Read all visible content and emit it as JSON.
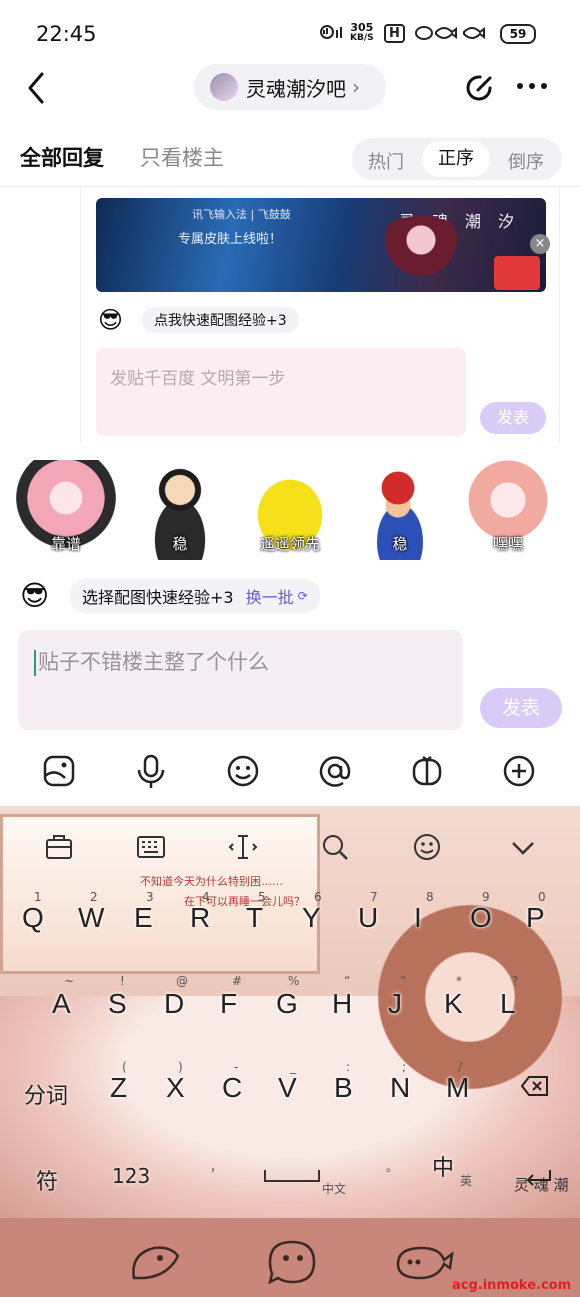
{
  "status_bar": {
    "time": "22:45",
    "net_speed": "305",
    "net_unit": "KB/S",
    "hd_label": "H",
    "battery": "59"
  },
  "nav": {
    "forum_name": "灵魂潮汐吧",
    "forum_chevron": "›"
  },
  "tabs": {
    "all_replies": "全部回复",
    "op_only": "只看楼主",
    "sort_hot": "热门",
    "sort_asc": "正序",
    "sort_desc": "倒序"
  },
  "upper_reply": {
    "banner_line1": "讯飞输入法 | 飞鼓鼓",
    "banner_line2": "专属皮肤上线啦！",
    "banner_title": "灵 魂 潮 汐",
    "banner_close": "×",
    "quick_tip": "点我快速配图经验+3",
    "input_placeholder": "发贴千百度 文明第一步",
    "send_label": "发表"
  },
  "stickers": [
    {
      "label": "靠谱"
    },
    {
      "label": "稳"
    },
    {
      "label": "遥遥领先"
    },
    {
      "label": "稳"
    },
    {
      "label": "嘿嘿"
    }
  ],
  "quick_pick": {
    "text": "选择配图快速经验+3",
    "swap": "换一批"
  },
  "main_input": {
    "placeholder": "贴子不错楼主整了个什么",
    "send_label": "发表"
  },
  "toolbar_icons": [
    "image-icon",
    "microphone-icon",
    "emoji-icon",
    "mention-icon",
    "gift-icon",
    "add-icon"
  ],
  "keyboard": {
    "caption_line1": "不知道今天为什么特别困……",
    "caption_line2": "在下可以再睡一会儿吗？",
    "row1": [
      {
        "k": "Q",
        "n": "1"
      },
      {
        "k": "W",
        "n": "2"
      },
      {
        "k": "E",
        "n": "3"
      },
      {
        "k": "R",
        "n": "4"
      },
      {
        "k": "T",
        "n": "5"
      },
      {
        "k": "Y",
        "n": "6"
      },
      {
        "k": "U",
        "n": "7"
      },
      {
        "k": "I",
        "n": "8"
      },
      {
        "k": "O",
        "n": "9"
      },
      {
        "k": "P",
        "n": "0"
      }
    ],
    "row2": [
      {
        "k": "A",
        "n": "~"
      },
      {
        "k": "S",
        "n": "!"
      },
      {
        "k": "D",
        "n": "@"
      },
      {
        "k": "F",
        "n": "#"
      },
      {
        "k": "G",
        "n": "%"
      },
      {
        "k": "H",
        "n": "“"
      },
      {
        "k": "J",
        "n": "”"
      },
      {
        "k": "K",
        "n": "*"
      },
      {
        "k": "L",
        "n": "?"
      }
    ],
    "row3": [
      {
        "k": "Z",
        "n": "("
      },
      {
        "k": "X",
        "n": ")"
      },
      {
        "k": "C",
        "n": "-"
      },
      {
        "k": "V",
        "n": "_"
      },
      {
        "k": "B",
        "n": ":"
      },
      {
        "k": "N",
        "n": ";"
      },
      {
        "k": "M",
        "n": "/"
      }
    ],
    "fenci": "分词",
    "symbols": "符",
    "numbers": "123",
    "space_label": "中文",
    "comma": "，",
    "period": "。",
    "lang_switch": "中",
    "lang_sub": "英",
    "brand": "灵 魂 潮",
    "delete_icon": "backspace-icon",
    "enter_icon": "enter-icon"
  },
  "watermark": "acg.inmoke.com"
}
